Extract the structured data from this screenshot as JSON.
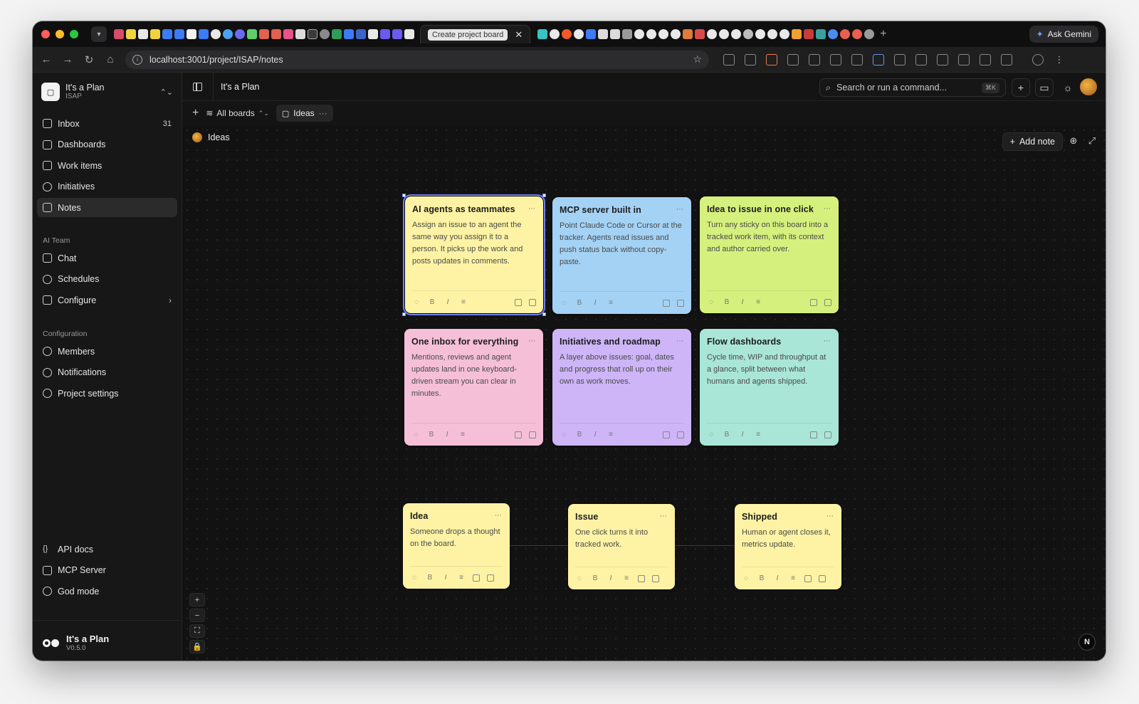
{
  "browser": {
    "active_tab_title": "Create project board",
    "url": "localhost:3001/project/ISAP/notes",
    "ask_gemini_label": "Ask Gemini"
  },
  "workspace": {
    "name": "It's a Plan",
    "key": "ISAP"
  },
  "sidebar": {
    "primary": [
      {
        "label": "Inbox",
        "badge": "31",
        "icon": "inbox-icon"
      },
      {
        "label": "Dashboards",
        "icon": "dashboard-icon"
      },
      {
        "label": "Work items",
        "icon": "work-items-icon"
      },
      {
        "label": "Initiatives",
        "icon": "target-icon"
      },
      {
        "label": "Notes",
        "icon": "note-icon",
        "active": true
      }
    ],
    "ai_team_label": "AI Team",
    "ai_team": [
      {
        "label": "Chat",
        "icon": "chat-icon"
      },
      {
        "label": "Schedules",
        "icon": "clock-icon"
      },
      {
        "label": "Configure",
        "icon": "sliders-icon"
      }
    ],
    "configuration_label": "Configuration",
    "configuration": [
      {
        "label": "Members",
        "icon": "users-icon"
      },
      {
        "label": "Notifications",
        "icon": "bell-icon"
      },
      {
        "label": "Project settings",
        "icon": "gear-icon"
      }
    ],
    "bottom": [
      {
        "label": "API docs",
        "icon": "braces-icon"
      },
      {
        "label": "MCP Server",
        "icon": "server-icon"
      },
      {
        "label": "God mode",
        "icon": "shield-icon"
      }
    ],
    "brand": {
      "name": "It's a Plan",
      "version": "V0.5.0"
    }
  },
  "topbar": {
    "title": "It's a Plan",
    "search_placeholder": "Search or run a command...",
    "search_shortcut": "⌘K"
  },
  "boardbar": {
    "all_boards_label": "All boards",
    "current_board": "Ideas"
  },
  "canvas": {
    "title": "Ideas",
    "add_note_label": "Add note",
    "notes": [
      {
        "title": "AI agents as teammates",
        "body": "Assign an issue to an agent the same way you assign it to a person. It picks up the work and posts updates in comments.",
        "color": "#fef3a4"
      },
      {
        "title": "MCP server built in",
        "body": "Point Claude Code or Cursor at the tracker. Agents read issues and push status back without copy-paste.",
        "color": "#a4d2f5"
      },
      {
        "title": "Idea to issue in one click",
        "body": "Turn any sticky on this board into a tracked work item, with its context and author carried over.",
        "color": "#d6f07e"
      },
      {
        "title": "One inbox for everything",
        "body": "Mentions, reviews and agent updates land in one keyboard-driven stream you can clear in minutes.",
        "color": "#f5bfd8"
      },
      {
        "title": "Initiatives and roadmap",
        "body": "A layer above issues: goal, dates and progress that roll up on their own as work moves.",
        "color": "#cdb5f7"
      },
      {
        "title": "Flow dashboards",
        "body": "Cycle time, WIP and throughput at a glance, split between what humans and agents shipped.",
        "color": "#a9e6d7"
      },
      {
        "title": "Idea",
        "body": "Someone drops a thought on the board.",
        "color": "#fef3a4"
      },
      {
        "title": "Issue",
        "body": "One click turns it into tracked work.",
        "color": "#fef3a4"
      },
      {
        "title": "Shipped",
        "body": "Human or agent closes it, metrics update.",
        "color": "#fef3a4"
      }
    ]
  },
  "zoom_controls": {
    "zoom_in": "+",
    "zoom_out": "−",
    "fit": "⛶",
    "lock": "🔒"
  },
  "corner_badge": "N"
}
